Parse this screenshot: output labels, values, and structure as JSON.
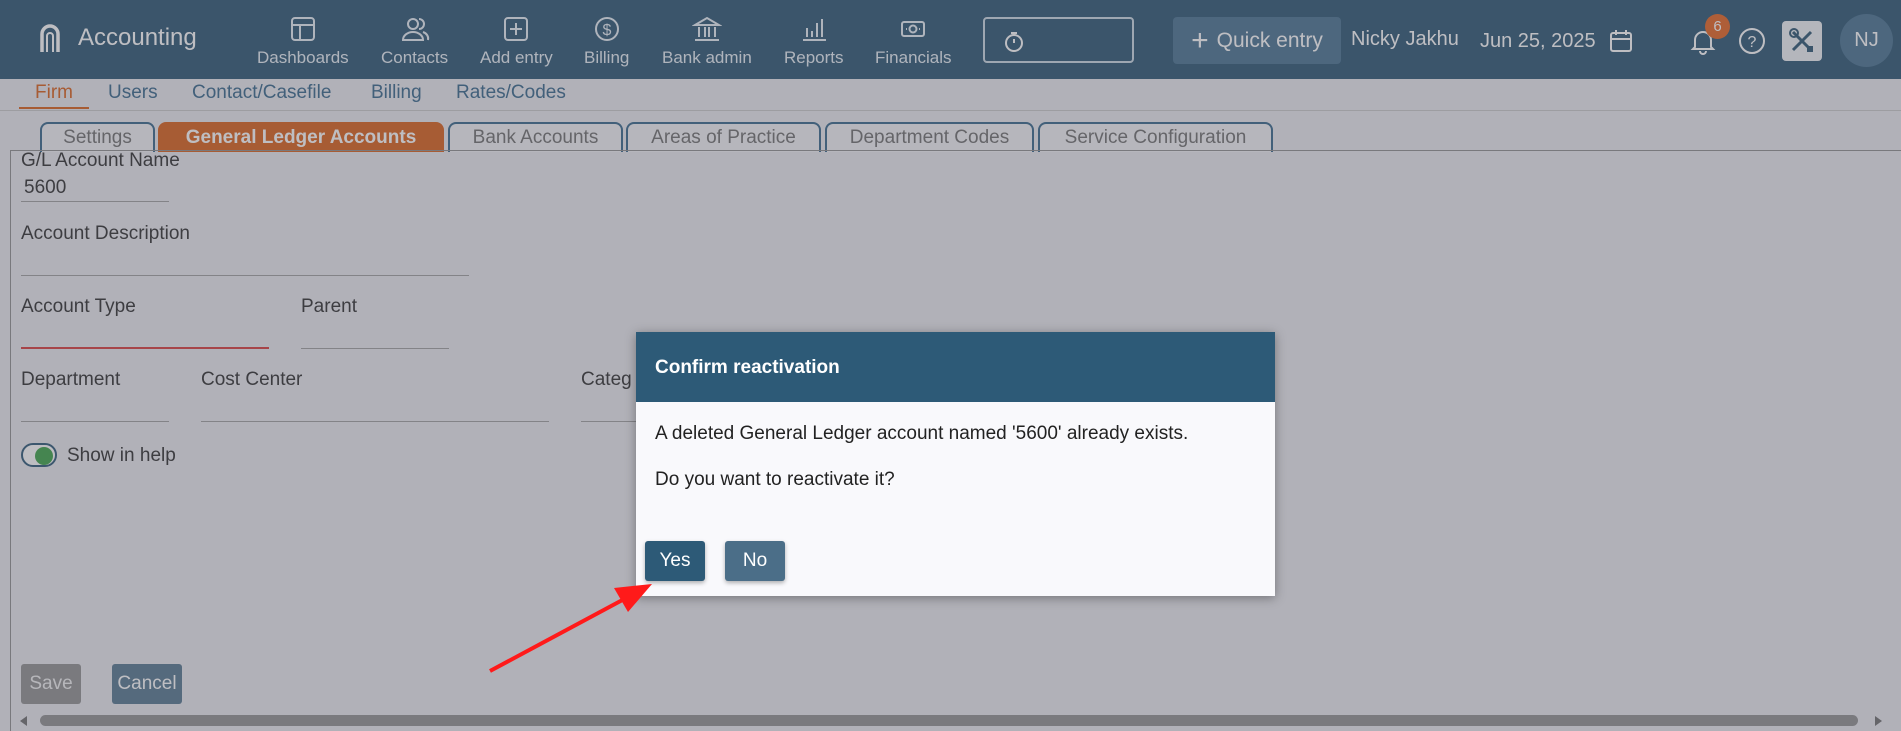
{
  "app": {
    "title": "Accounting"
  },
  "nav": [
    {
      "label": "Dashboards",
      "icon": "dashboard-icon"
    },
    {
      "label": "Contacts",
      "icon": "contacts-icon"
    },
    {
      "label": "Add entry",
      "icon": "add-entry-icon"
    },
    {
      "label": "Billing",
      "icon": "billing-icon"
    },
    {
      "label": "Bank admin",
      "icon": "bank-icon"
    },
    {
      "label": "Reports",
      "icon": "reports-icon"
    },
    {
      "label": "Financials",
      "icon": "financials-icon"
    }
  ],
  "header": {
    "quick_entry": "Quick entry",
    "user_name": "Nicky Jakhu",
    "date": "Jun 25, 2025",
    "notification_count": "6",
    "avatar_initials": "NJ"
  },
  "subnav": [
    "Firm",
    "Users",
    "Contact/Casefile",
    "Billing",
    "Rates/Codes"
  ],
  "tabs": [
    "Settings",
    "General Ledger Accounts",
    "Bank Accounts",
    "Areas of Practice",
    "Department Codes",
    "Service Configuration"
  ],
  "form": {
    "gl_name_label": "G/L Account Name",
    "gl_name_value": "5600",
    "description_label": "Account Description",
    "account_type_label": "Account Type",
    "parent_label": "Parent",
    "department_label": "Department",
    "cost_center_label": "Cost Center",
    "category_label": "Categ",
    "show_in_help_label": "Show in help",
    "save_label": "Save",
    "cancel_label": "Cancel"
  },
  "dialog": {
    "title": "Confirm reactivation",
    "message": "A deleted General Ledger account named '5600' already exists.",
    "question": "Do you want to reactivate it?",
    "yes_label": "Yes",
    "no_label": "No"
  },
  "colors": {
    "header_bg": "#1e4a69",
    "accent": "#d8560c",
    "dialog_header": "#2d5a77",
    "toggle_on": "#2f9d3c",
    "annotation_arrow": "#ff1a1a"
  }
}
